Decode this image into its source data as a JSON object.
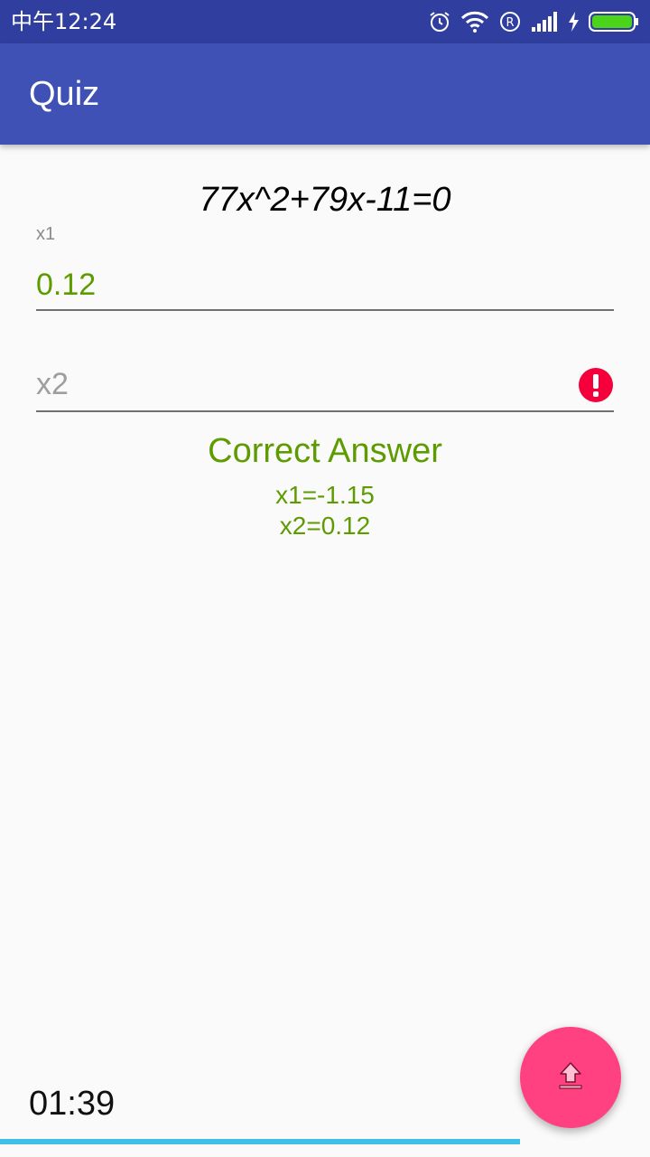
{
  "status_bar": {
    "time": "中午12:24",
    "icons": [
      "alarm-icon",
      "wifi-icon",
      "registered-icon",
      "signal-icon",
      "charging-icon",
      "battery-icon"
    ]
  },
  "app_bar": {
    "title": "Quiz"
  },
  "quiz": {
    "equation": "77x^2+79x-11=0",
    "x1_label": "x1",
    "x1_value": "0.12",
    "x2_placeholder": "x2",
    "x2_value": "",
    "correct_answer_title": "Correct Answer",
    "correct_x1": "x1=-1.15",
    "correct_x2": "x2=0.12"
  },
  "footer": {
    "timer": "01:39",
    "progress": 0.8
  },
  "fab": {
    "icon": "upload-icon"
  },
  "colors": {
    "primary": "#3f51b5",
    "primary_dark": "#303f9f",
    "accent": "#ff4081",
    "correct": "#5e9b00",
    "error": "#f5003a",
    "progress": "#3fc0e8"
  }
}
